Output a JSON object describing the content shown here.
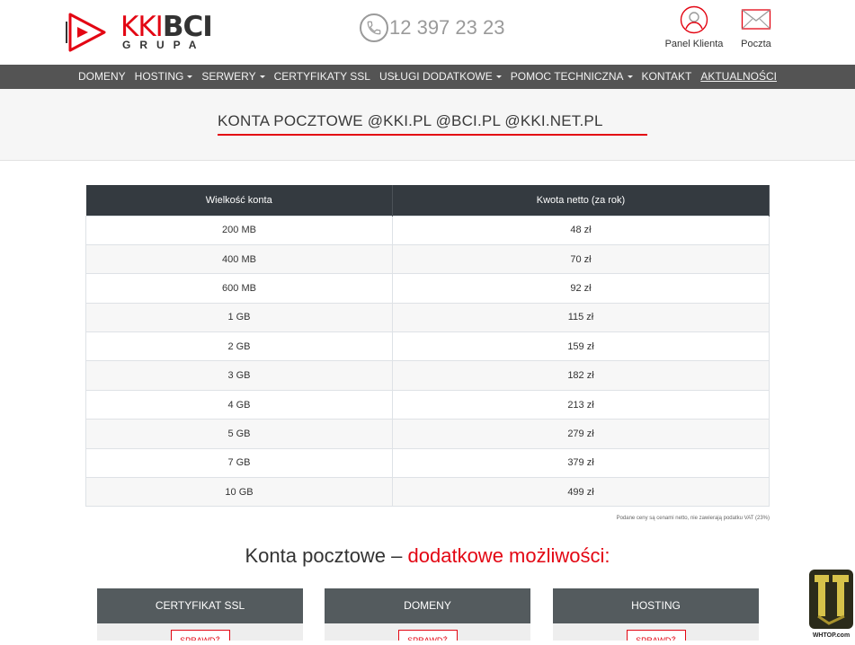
{
  "brand": {
    "name_part1": "KKI",
    "name_part2": "BCI",
    "subtitle": "GRUPA",
    "accent": "#e30613"
  },
  "header": {
    "phone": "12 397 23 23",
    "panel_label": "Panel Klienta",
    "mail_label": "Poczta"
  },
  "nav": {
    "items": [
      {
        "label": "DOMENY",
        "dropdown": false
      },
      {
        "label": "HOSTING",
        "dropdown": true
      },
      {
        "label": "SERWERY",
        "dropdown": true
      },
      {
        "label": "CERTYFIKATY SSL",
        "dropdown": false
      },
      {
        "label": "USŁUGI DODATKOWE",
        "dropdown": true
      },
      {
        "label": "POMOC TECHNICZNA",
        "dropdown": true
      },
      {
        "label": "KONTAKT",
        "dropdown": false
      },
      {
        "label": "AKTUALNOŚCI",
        "dropdown": false
      }
    ]
  },
  "hero": {
    "title": "KONTA POCZTOWE @KKI.PL @BCI.PL @KKI.NET.PL"
  },
  "price_table": {
    "headers": [
      "Wielkość konta",
      "Kwota netto (za rok)"
    ],
    "rows": [
      [
        "200 MB",
        "48 zł"
      ],
      [
        "400 MB",
        "70 zł"
      ],
      [
        "600 MB",
        "92 zł"
      ],
      [
        "1 GB",
        "115 zł"
      ],
      [
        "2 GB",
        "159 zł"
      ],
      [
        "3 GB",
        "182 zł"
      ],
      [
        "4 GB",
        "213 zł"
      ],
      [
        "5 GB",
        "279 zł"
      ],
      [
        "7 GB",
        "379 zł"
      ],
      [
        "10 GB",
        "499 zł"
      ]
    ],
    "note": "Podane ceny są cenami netto, nie zawierają podatku VAT (23%)"
  },
  "extras": {
    "title_plain": "Konta pocztowe – ",
    "title_accent": "dodatkowe możliwości:",
    "cards": [
      {
        "title": "CERTYFIKAT SSL",
        "button": "SPRAWDŹ"
      },
      {
        "title": "DOMENY",
        "button": "SPRAWDŹ"
      },
      {
        "title": "HOSTING",
        "button": "SPRAWDŹ"
      }
    ]
  },
  "watermark": {
    "text": "WHTOP.com"
  }
}
